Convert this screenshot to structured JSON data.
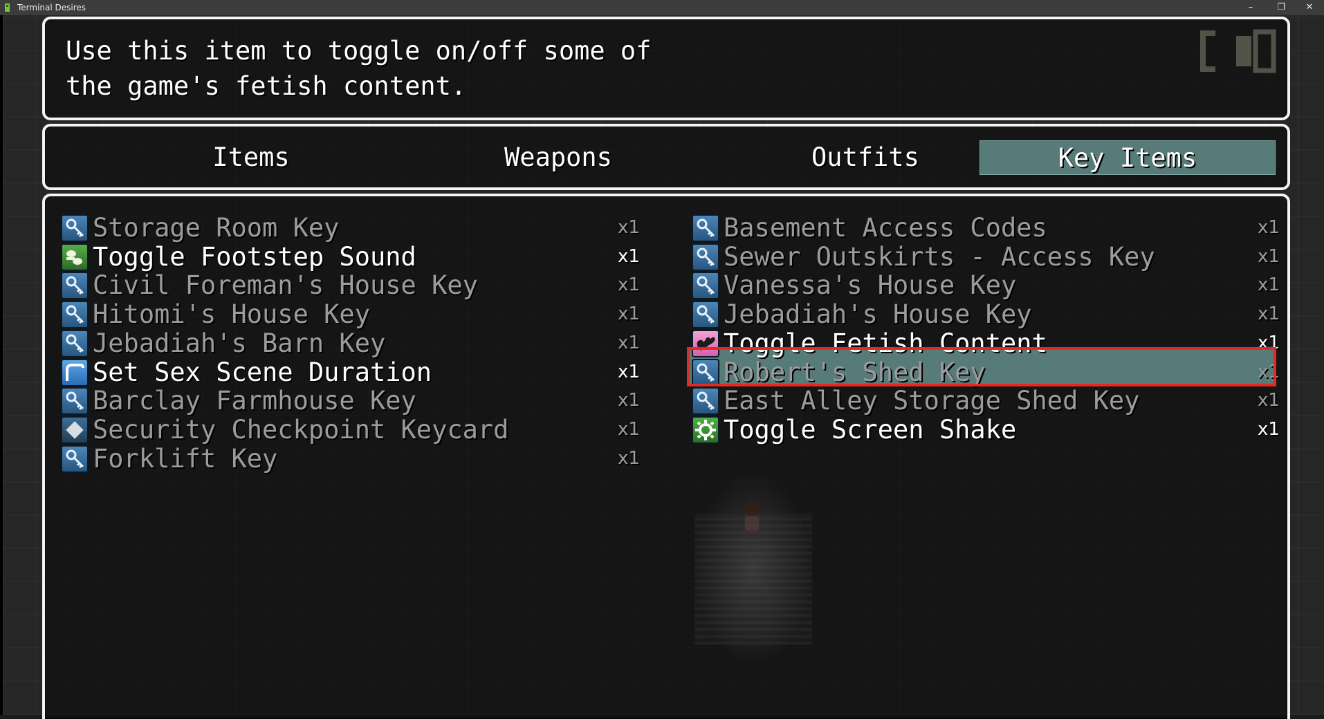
{
  "window": {
    "title": "Terminal Desires",
    "minimize": "–",
    "restore": "❐",
    "close": "✕"
  },
  "help": {
    "line1": "Use this item to toggle on/off some of",
    "line2": "the game's fetish content."
  },
  "tabs": [
    {
      "label": "Items",
      "active": false
    },
    {
      "label": "Weapons",
      "active": false
    },
    {
      "label": "Outfits",
      "active": false
    },
    {
      "label": "Key Items",
      "active": true
    }
  ],
  "items_left": [
    {
      "name": "Storage Room Key",
      "qty": "x1",
      "icon": "key-icon",
      "enabled": false
    },
    {
      "name": "Toggle Footstep Sound",
      "qty": "x1",
      "icon": "footstep-icon",
      "enabled": true
    },
    {
      "name": "Civil Foreman's House Key",
      "qty": "x1",
      "icon": "key-icon",
      "enabled": false
    },
    {
      "name": "Hitomi's House Key",
      "qty": "x1",
      "icon": "key-icon",
      "enabled": false
    },
    {
      "name": "Jebadiah's Barn Key",
      "qty": "x1",
      "icon": "key-icon",
      "enabled": false
    },
    {
      "name": "Set Sex Scene Duration",
      "qty": "x1",
      "icon": "timer-icon",
      "enabled": true
    },
    {
      "name": "Barclay Farmhouse Key",
      "qty": "x1",
      "icon": "key-icon",
      "enabled": false
    },
    {
      "name": "Security Checkpoint Keycard",
      "qty": "x1",
      "icon": "keycard-icon",
      "enabled": false
    },
    {
      "name": "Forklift Key",
      "qty": "x1",
      "icon": "key-icon",
      "enabled": false
    }
  ],
  "items_right": [
    {
      "name": "Basement Access Codes",
      "qty": "x1",
      "icon": "key-icon",
      "enabled": false
    },
    {
      "name": "Sewer Outskirts - Access Key",
      "qty": "x1",
      "icon": "key-icon",
      "enabled": false
    },
    {
      "name": "Vanessa's House Key",
      "qty": "x1",
      "icon": "key-icon",
      "enabled": false
    },
    {
      "name": "Jebadiah's House Key",
      "qty": "x1",
      "icon": "key-icon",
      "enabled": false
    },
    {
      "name": "Toggle Fetish Content",
      "qty": "x1",
      "icon": "heart-icon",
      "enabled": true,
      "selected": true
    },
    {
      "name": "Robert's Shed Key",
      "qty": "x1",
      "icon": "key-icon",
      "enabled": false
    },
    {
      "name": "East Alley Storage Shed Key",
      "qty": "x1",
      "icon": "key-icon",
      "enabled": false
    },
    {
      "name": "Toggle Screen Shake",
      "qty": "x1",
      "icon": "gear-icon",
      "enabled": true
    }
  ],
  "colors": {
    "selection": "#577b78",
    "highlight_outline": "#e12a24",
    "disabled_text": "#9c9c9c",
    "enabled_text": "#ffffff"
  }
}
